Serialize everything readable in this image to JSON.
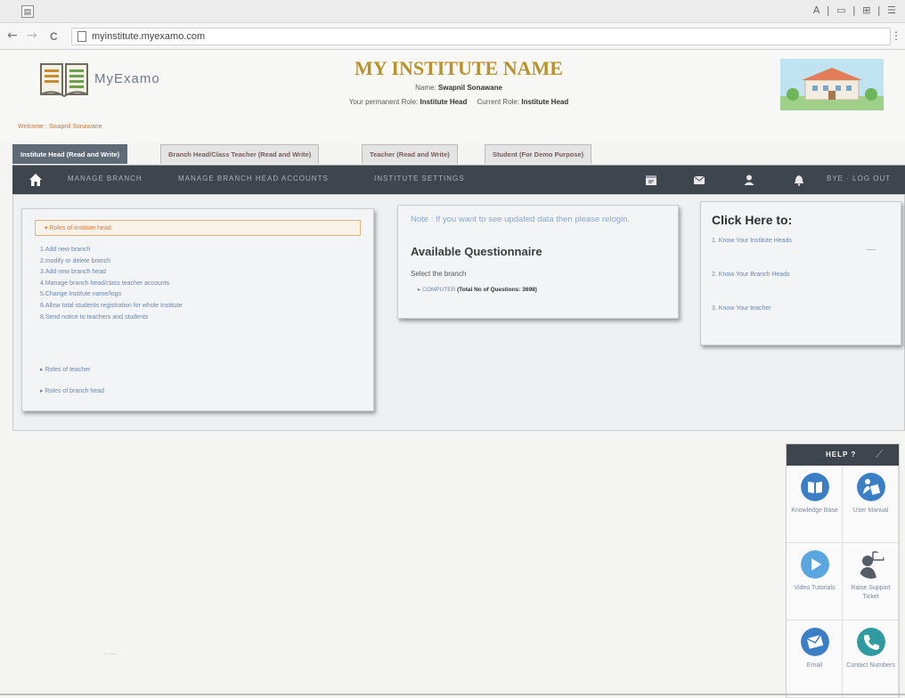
{
  "browser": {
    "tab_icon": "page-icon",
    "window_controls": "A | ▭ | ⊞ | ☰",
    "back": "←",
    "forward": "→",
    "reload": "C",
    "url": "myinstitute.myexamo.com",
    "menu": "⋮"
  },
  "header": {
    "logo_text": "MyExamo",
    "institute_name": "MY INSTITUTE NAME",
    "name_label": "Name:",
    "name_value": "Swapnil Sonawane",
    "perm_role_label": "Your permanent Role:",
    "perm_role_value": "Institute Head",
    "current_role_label": "Current Role:",
    "current_role_value": "Institute Head",
    "welcome": "Welcome : Swapnil Sonawane"
  },
  "role_tabs": [
    {
      "label": "Institute Head (Read and Write)",
      "active": true
    },
    {
      "label": "Branch Head/Class Teacher (Read and Write)",
      "active": false
    },
    {
      "label": "Teacher (Read and Write)",
      "active": false
    },
    {
      "label": "Student (For Demo Purpose)",
      "active": false
    }
  ],
  "navbar": {
    "home_icon": "home-icon",
    "links": [
      "MANAGE BRANCH",
      "MANAGE BRANCH HEAD ACCOUNTS",
      "INSTITUTE SETTINGS"
    ],
    "icons": [
      "calendar-icon",
      "mail-icon",
      "user-icon",
      "bell-icon"
    ],
    "logout": "BYE · LOG OUT"
  },
  "left_panel": {
    "roles_header": "▾ Roles of institute head",
    "items": [
      "1.Add new branch",
      "2.modify or delete branch",
      "3.Add new branch head",
      "4.Manage branch head/class teacher accounts",
      "5.Change Institute name/logo",
      "6.Allow total students registration for whole Institute",
      "8.Send notice to teachers and students"
    ],
    "teacher_roles": "▸ Roles of teacher",
    "branch_head_roles": "▸ Roles of branch head"
  },
  "mid_panel": {
    "note": "Note : If you want to see updated data then please relogin.",
    "title": "Available Questionnaire",
    "select_label": "Select the branch",
    "branch_name": "▸ COMPUTER",
    "branch_count": "(Total No of Questions: 3698)"
  },
  "right_panel": {
    "title": "Click Here to:",
    "links": [
      "1. Know Your Institute Heads",
      "2. Know Your Branch Heads",
      "3. Know Your teacher"
    ],
    "dash": "—"
  },
  "help": {
    "title": "HELP ?",
    "tool_icon": "wrench-icon",
    "items": [
      {
        "label": "Knowledge Base",
        "icon": "book-icon",
        "color": "#3a7fc6"
      },
      {
        "label": "User Manual",
        "icon": "user-manual-icon",
        "color": "#3a7fc6"
      },
      {
        "label": "Video Tutorials",
        "icon": "play-icon",
        "color": "#5aa6e0"
      },
      {
        "label": "Raise Support Ticket",
        "icon": "support-agent-icon",
        "color": "#555d66"
      },
      {
        "label": "Email",
        "icon": "email-icon",
        "color": "#3a7fc6"
      },
      {
        "label": "Contact Numbers",
        "icon": "phone-icon",
        "color": "#2f9aa0"
      }
    ]
  },
  "colors": {
    "navbar": "#3e454d",
    "institute_name": "#b8922a",
    "link": "#6b86b0",
    "accent_orange": "#d9773a"
  }
}
